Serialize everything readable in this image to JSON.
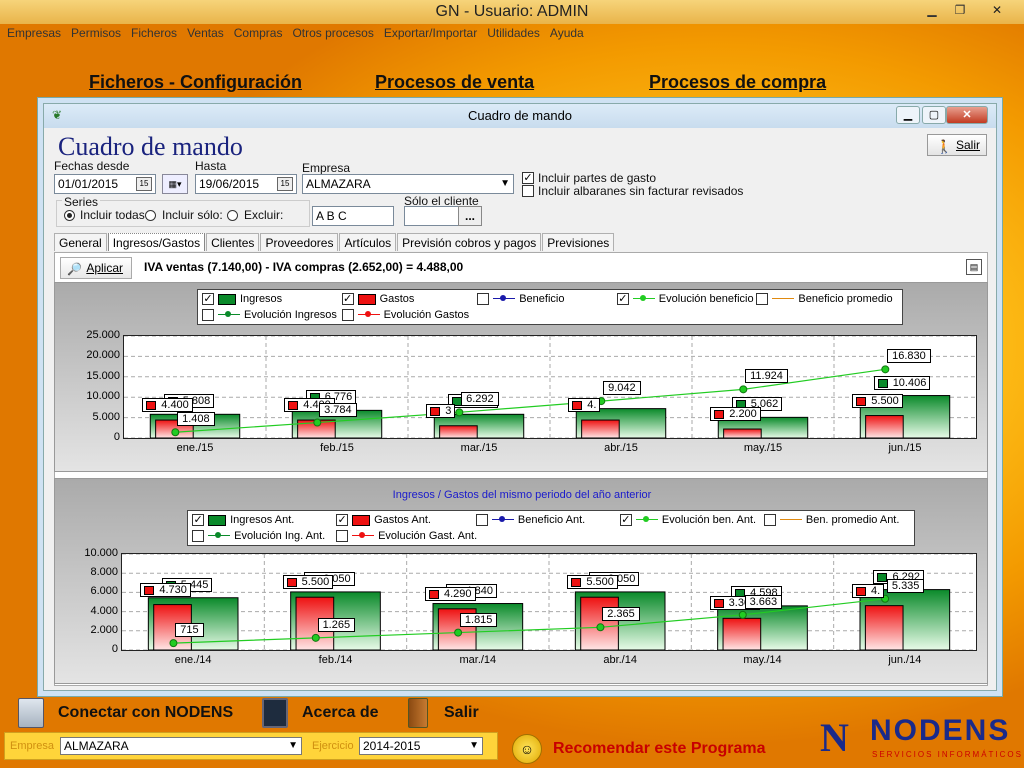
{
  "window": {
    "title": "GN - Usuario: ADMIN"
  },
  "menu": [
    "Empresas",
    "Permisos",
    "Ficheros",
    "Ventas",
    "Compras",
    "Otros procesos",
    "Exportar/Importar",
    "Utilidades",
    "Ayuda"
  ],
  "shortcuts": {
    "ficheros": "Ficheros - Configuración",
    "ventas": "Procesos de venta",
    "compras": "Procesos de compra"
  },
  "bottom": {
    "conectar": "Conectar con NODENS",
    "acerca": "Acerca de",
    "salir": "Salir",
    "recomendar": "Recomendar este Programa",
    "empresa_label": "Empresa",
    "empresa_value": "ALMAZARA",
    "ejercicio_label": "Ejercicio",
    "ejercicio_value": "2014-2015",
    "logo_main": "NODENS",
    "logo_sub": "SERVICIOS INFORMÁTICOS"
  },
  "dialog": {
    "title": "Cuadro de mando",
    "heading": "Cuadro de mando",
    "salir": "Salir",
    "fechas_desde_label": "Fechas desde",
    "fechas_desde": "01/01/2015",
    "hasta_label": "Hasta",
    "hasta": "19/06/2015",
    "empresa_label": "Empresa",
    "empresa": "ALMAZARA",
    "chk_partes": "Incluir partes de gasto",
    "chk_partes_checked": true,
    "chk_albaranes": "Incluir albaranes sin facturar revisados",
    "chk_albaranes_checked": false,
    "series_label": "Series",
    "series_todas": "Incluir todas",
    "series_solo": "Incluir sólo:",
    "series_excluir": "Excluir:",
    "series_value": "A B C",
    "cliente_label": "Sólo el cliente",
    "cliente_btn": "...",
    "tabs": [
      "General",
      "Ingresos/Gastos",
      "Clientes",
      "Proveedores",
      "Artículos",
      "Previsión cobros y pagos",
      "Previsiones"
    ],
    "active_tab": 1,
    "aplicar": "Aplicar",
    "iva_summary": "IVA ventas (7.140,00) - IVA compras (2.652,00) = 4.488,00"
  },
  "colors": {
    "ingresos": "#0a8a2a",
    "gastos": "#ee1111",
    "beneficio": "#1a1aaa",
    "evolucion": "#22cc22",
    "promedio": "#e08a10"
  },
  "chart_data": [
    {
      "type": "bar",
      "title": "",
      "legend": [
        {
          "label": "Ingresos",
          "checked": true,
          "kind": "bar",
          "color": "#0a8a2a"
        },
        {
          "label": "Gastos",
          "checked": true,
          "kind": "bar",
          "color": "#ee1111"
        },
        {
          "label": "Beneficio",
          "checked": false,
          "kind": "line",
          "color": "#1a1aaa"
        },
        {
          "label": "Evolución beneficio",
          "checked": true,
          "kind": "line",
          "color": "#22cc22"
        },
        {
          "label": "Beneficio promedio",
          "checked": false,
          "kind": "plain",
          "color": "#e08a10"
        },
        {
          "label": "Evolución Ingresos",
          "checked": false,
          "kind": "line",
          "color": "#0a8a2a"
        },
        {
          "label": "Evolución Gastos",
          "checked": false,
          "kind": "line",
          "color": "#ee1111"
        }
      ],
      "categories": [
        "ene./15",
        "feb./15",
        "mar./15",
        "abr./15",
        "may./15",
        "jun./15"
      ],
      "ylim": [
        0,
        25000
      ],
      "yticks": [
        "0",
        "5.000",
        "10.000",
        "15.000",
        "20.000",
        "25.000"
      ],
      "series": [
        {
          "name": "Ingresos",
          "values": [
            5808,
            6776,
            5808,
            7200,
            5062,
            10406
          ],
          "labels": [
            "5.808",
            "6.776",
            "5.808",
            "",
            "5.062",
            "10.406"
          ]
        },
        {
          "name": "Gastos",
          "values": [
            4400,
            4400,
            3000,
            4400,
            2200,
            5500
          ],
          "labels": [
            "4.400",
            "4.400",
            "3",
            "4.",
            "2.200",
            "5.500"
          ]
        },
        {
          "name": "Evolución beneficio",
          "values": [
            1408,
            3784,
            6292,
            9042,
            11924,
            16830
          ],
          "labels": [
            "1.408",
            "3.784",
            "6.292",
            "9.042",
            "11.924",
            "16.830"
          ]
        }
      ]
    },
    {
      "type": "bar",
      "title": "Ingresos / Gastos del mismo periodo del año anterior",
      "legend": [
        {
          "label": "Ingresos Ant.",
          "checked": true,
          "kind": "bar",
          "color": "#0a8a2a"
        },
        {
          "label": "Gastos Ant.",
          "checked": true,
          "kind": "bar",
          "color": "#ee1111"
        },
        {
          "label": "Beneficio Ant.",
          "checked": false,
          "kind": "line",
          "color": "#1a1aaa"
        },
        {
          "label": "Evolución ben. Ant.",
          "checked": true,
          "kind": "line",
          "color": "#22cc22"
        },
        {
          "label": "Ben. promedio Ant.",
          "checked": false,
          "kind": "plain",
          "color": "#e08a10"
        },
        {
          "label": "Evolución Ing. Ant.",
          "checked": false,
          "kind": "line",
          "color": "#0a8a2a"
        },
        {
          "label": "Evolución Gast. Ant.",
          "checked": false,
          "kind": "line",
          "color": "#ee1111"
        }
      ],
      "categories": [
        "ene./14",
        "feb./14",
        "mar./14",
        "abr./14",
        "may./14",
        "jun./14"
      ],
      "ylim": [
        0,
        10000
      ],
      "yticks": [
        "0",
        "2.000",
        "4.000",
        "6.000",
        "8.000",
        "10.000"
      ],
      "series": [
        {
          "name": "Ingresos Ant.",
          "values": [
            5445,
            6050,
            4840,
            6050,
            4598,
            6292
          ],
          "labels": [
            "5.445",
            "6.050",
            "4.840",
            "6.050",
            "4.598",
            "6.292"
          ]
        },
        {
          "name": "Gastos Ant.",
          "values": [
            4730,
            5500,
            4290,
            5500,
            3300,
            4620
          ],
          "labels": [
            "4.730",
            "5.500",
            "4.290",
            "5.500",
            "3.300",
            "4."
          ]
        },
        {
          "name": "Evolución ben. Ant.",
          "values": [
            715,
            1265,
            1815,
            2365,
            3663,
            5335
          ],
          "labels": [
            "715",
            "1.265",
            "1.815",
            "2.365",
            "3.663",
            "5.335"
          ]
        }
      ]
    }
  ]
}
